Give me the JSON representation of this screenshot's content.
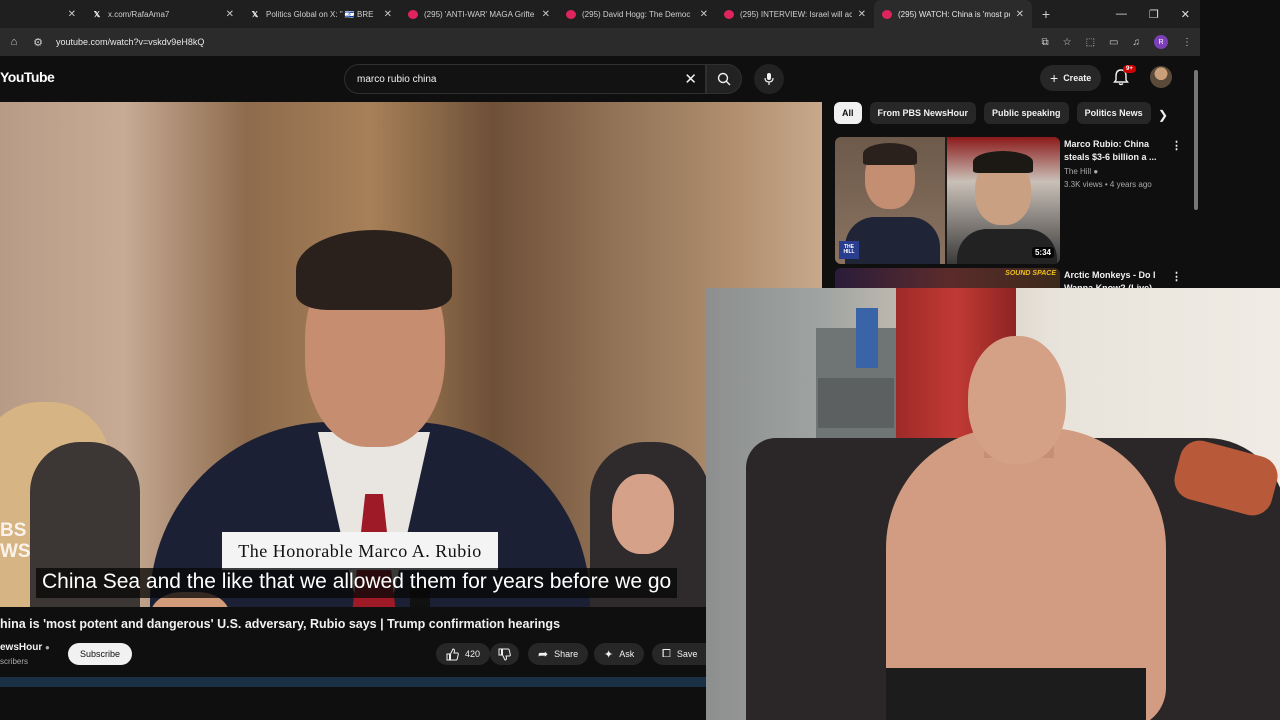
{
  "browser": {
    "tabs": [
      {
        "title": "",
        "icon": "x",
        "active": false
      },
      {
        "title": "x.com/RafaAma7",
        "icon": "x",
        "active": false
      },
      {
        "title": "Politics Global on X: \" 🇮🇱 BRE",
        "icon": "x",
        "active": false
      },
      {
        "title": "(295) 'ANTI-WAR' MAGA Grifte",
        "icon": "youtube",
        "active": false
      },
      {
        "title": "(295) David Hogg: The Democ",
        "icon": "youtube",
        "active": false
      },
      {
        "title": "(295) INTERVIEW: Israel will ac",
        "icon": "youtube",
        "active": false
      },
      {
        "title": "(295) WATCH: China is 'most po",
        "icon": "youtube",
        "active": true
      }
    ],
    "url": "youtube.com/watch?v=vskdv9eH8kQ",
    "profile_initial": "R"
  },
  "youtube": {
    "logo": "YouTube",
    "search": {
      "value": "marco rubio china",
      "placeholder": "Search"
    },
    "create_label": "Create",
    "notification_badge": "9+"
  },
  "video": {
    "nameplate": "The Honorable Marco A. Rubio",
    "pbs_watermark": "BS\nWS",
    "caption": "China Sea and the like that we allowed them for years before we go",
    "title": "hina is 'most potent and dangerous' U.S. adversary, Rubio says | Trump confirmation hearings",
    "channel": "ewsHour",
    "subscribers": "scribers",
    "subscribe_label": "Subscribe",
    "like_count": "420",
    "share_label": "Share",
    "ask_label": "Ask",
    "save_label": "Save"
  },
  "sidebar": {
    "chips": [
      "All",
      "From PBS NewsHour",
      "Public speaking",
      "Politics News"
    ],
    "related": [
      {
        "title": "Marco Rubio: China steals $3-6 billion a ...",
        "channel": "The Hill",
        "meta": "3.3K views • 4 years ago",
        "duration": "5:34",
        "thumb_badge": "THE HILL"
      },
      {
        "title": "Arctic Monkeys - Do I Wanna Know? (Live)",
        "thumb_badge": "SOUND SPACE"
      }
    ]
  },
  "colors": {
    "background": "#0f0f0f",
    "chip_active": "#f1f1f1",
    "youtube_red": "#cc0000"
  }
}
